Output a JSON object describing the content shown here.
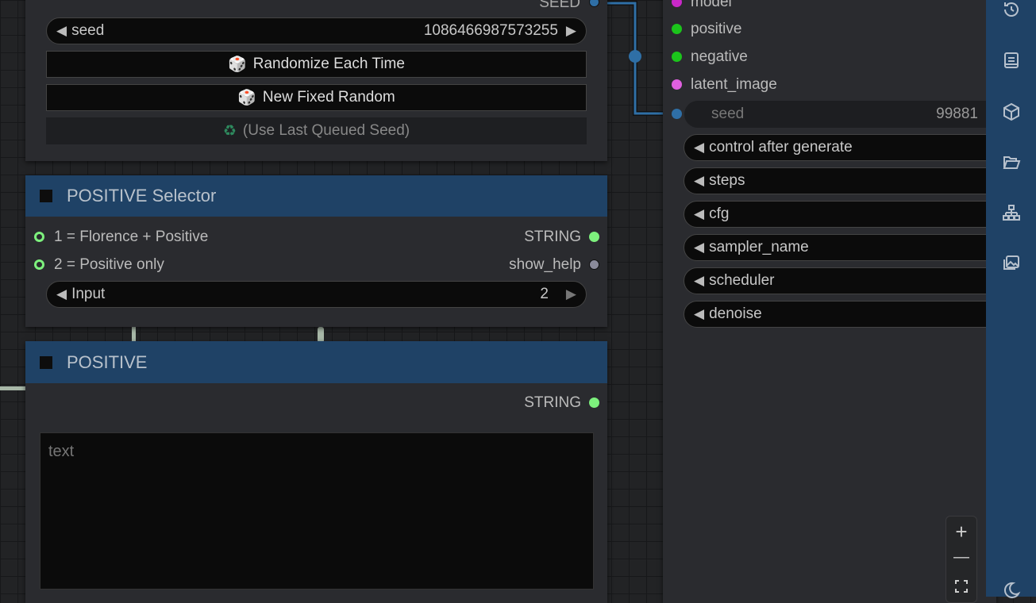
{
  "seed_node": {
    "output_label": "SEED",
    "seed_label": "seed",
    "seed_value": "1086466987573255",
    "randomize_label": "Randomize Each Time",
    "fixed_label": "New Fixed Random",
    "last_label": "(Use Last Queued Seed)"
  },
  "selector_node": {
    "title": "POSITIVE Selector",
    "inputs": [
      "1 = Florence + Positive",
      "2 = Positive only"
    ],
    "outputs": [
      "STRING",
      "show_help"
    ],
    "input_widget_label": "Input",
    "input_widget_value": "2"
  },
  "positive_node": {
    "title": "POSITIVE",
    "output": "STRING",
    "text_placeholder": "text"
  },
  "sampler_node": {
    "inputs": [
      "model",
      "positive",
      "negative",
      "latent_image"
    ],
    "seed_label": "seed",
    "seed_value": "99881",
    "widgets": [
      "control after generate",
      "steps",
      "cfg",
      "sampler_name",
      "scheduler",
      "denoise"
    ]
  },
  "colors": {
    "header": "#1f4266",
    "sidebar": "#1f4266",
    "link_blue": "#2f6fa6",
    "model": "#c928c9",
    "conditioning": "#1bc41b",
    "latent": "#e060e0",
    "string": "#7df07d"
  },
  "zoom_controls": {
    "zoom_in": "+",
    "zoom_out": "—"
  }
}
